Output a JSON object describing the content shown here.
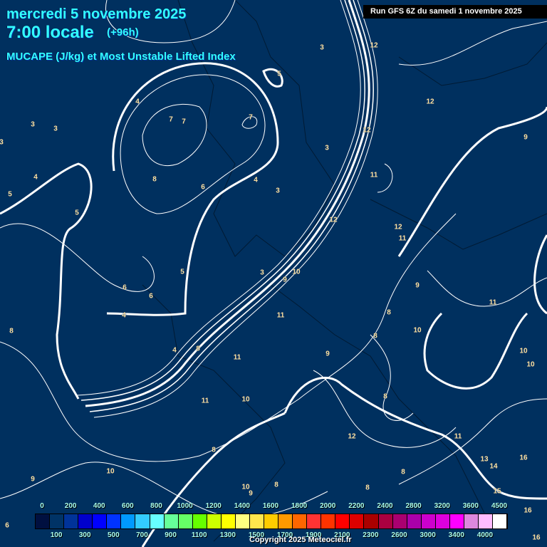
{
  "header": {
    "date": "mercredi 5 novembre 2025",
    "time": "7:00 locale",
    "lead": "(+96h)",
    "parameter": "MUCAPE (J/kg) et Most Unstable Lifted Index",
    "run": "Run GFS 6Z du samedi 1 novembre 2025"
  },
  "contour_labels": [
    "3",
    "12",
    "5",
    "4",
    "12",
    "3",
    "3",
    "7",
    "7",
    "7",
    "12",
    "9",
    "3",
    "3",
    "4",
    "8",
    "6",
    "4",
    "11",
    "3",
    "5",
    "5",
    "12",
    "12",
    "11",
    "3",
    "10",
    "5",
    "9",
    "6",
    "6",
    "9",
    "4",
    "11",
    "8",
    "11",
    "8",
    "10",
    "8",
    "4",
    "8",
    "9",
    "10",
    "10",
    "11",
    "8",
    "11",
    "10",
    "12",
    "11",
    "8",
    "13",
    "16",
    "14",
    "8",
    "10",
    "9",
    "10",
    "8",
    "9",
    "15",
    "8",
    "16",
    "16",
    "6"
  ],
  "colorbar": {
    "colors": [
      "#001040",
      "#003366",
      "#003399",
      "#0000cc",
      "#0000ff",
      "#0033ff",
      "#0099ff",
      "#33ccff",
      "#66ffff",
      "#66ff99",
      "#66ff66",
      "#66ff00",
      "#ccff00",
      "#ffff00",
      "#ffff80",
      "#ffe64d",
      "#ffcc00",
      "#ff9900",
      "#ff6600",
      "#ff3333",
      "#ff3300",
      "#ff0000",
      "#dd0000",
      "#aa0000",
      "#aa0040",
      "#aa0070",
      "#aa00aa",
      "#cc00cc",
      "#dd00dd",
      "#ff00ff",
      "#dd88dd",
      "#ffbbff",
      "#ffffff"
    ],
    "top_labels": [
      "0",
      "200",
      "400",
      "600",
      "800",
      "1000",
      "1200",
      "1400",
      "1600",
      "1800",
      "2000",
      "2200",
      "2400",
      "2800",
      "3200",
      "3600",
      "4500"
    ],
    "bottom_labels": [
      "100",
      "300",
      "500",
      "700",
      "900",
      "1100",
      "1300",
      "1500",
      "1700",
      "1900",
      "2100",
      "2300",
      "2600",
      "3000",
      "3400",
      "4000"
    ]
  },
  "copyright": "Copyright 2025 Meteociel.fr"
}
